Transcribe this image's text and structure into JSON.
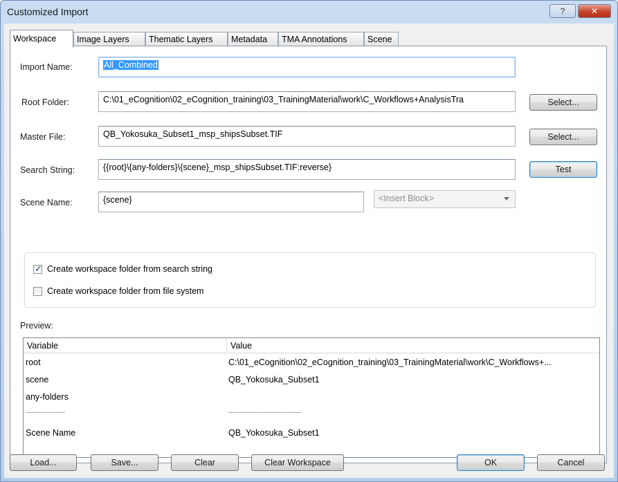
{
  "window": {
    "title": "Customized Import",
    "help_label": "?",
    "close_label": "✕"
  },
  "tabs": [
    "Workspace",
    "Image Layers",
    "Thematic Layers",
    "Metadata",
    "TMA Annotations",
    "Scene"
  ],
  "form": {
    "import_name": {
      "label": "Import Name:",
      "value": "All_Combined"
    },
    "root_folder": {
      "label": "Root Folder:",
      "value": "C:\\01_eCognition\\02_eCognition_training\\03_TrainingMaterial\\work\\C_Workflows+AnalysisTra",
      "button": "Select..."
    },
    "master_file": {
      "label": "Master File:",
      "value": "QB_Yokosuka_Subset1_msp_shipsSubset.TIF",
      "button": "Select..."
    },
    "search_string": {
      "label": "Search String:",
      "value": "{{root}\\{any-folders}\\{scene}_msp_shipsSubset.TIF:reverse}",
      "button": "Test"
    },
    "scene_name": {
      "label": "Scene Name:",
      "value": "{scene}",
      "insert_block": "<Insert Block>"
    }
  },
  "options": {
    "from_search_string": {
      "label": "Create workspace folder from search string",
      "checked": true
    },
    "from_file_system": {
      "label": "Create workspace folder from file system",
      "checked": false
    }
  },
  "preview": {
    "label": "Preview:",
    "columns": [
      "Variable",
      "Value"
    ],
    "rows": [
      {
        "name": "root",
        "value": "C:\\01_eCognition\\02_eCognition_training\\03_TrainingMaterial\\work\\C_Workflows+..."
      },
      {
        "name": "scene",
        "value": "QB_Yokosuka_Subset1"
      },
      {
        "name": "any-folders",
        "value": ""
      },
      {
        "name": "-------------------",
        "value": "-----------------------------------"
      },
      {
        "name": "Scene Name",
        "value": "QB_Yokosuka_Subset1"
      }
    ]
  },
  "buttons": {
    "load": "Load...",
    "save": "Save...",
    "clear": "Clear",
    "clear_workspace": "Clear Workspace",
    "ok": "OK",
    "cancel": "Cancel"
  },
  "colors": {
    "selection": "#3399ff",
    "close_button": "#c7432a"
  }
}
